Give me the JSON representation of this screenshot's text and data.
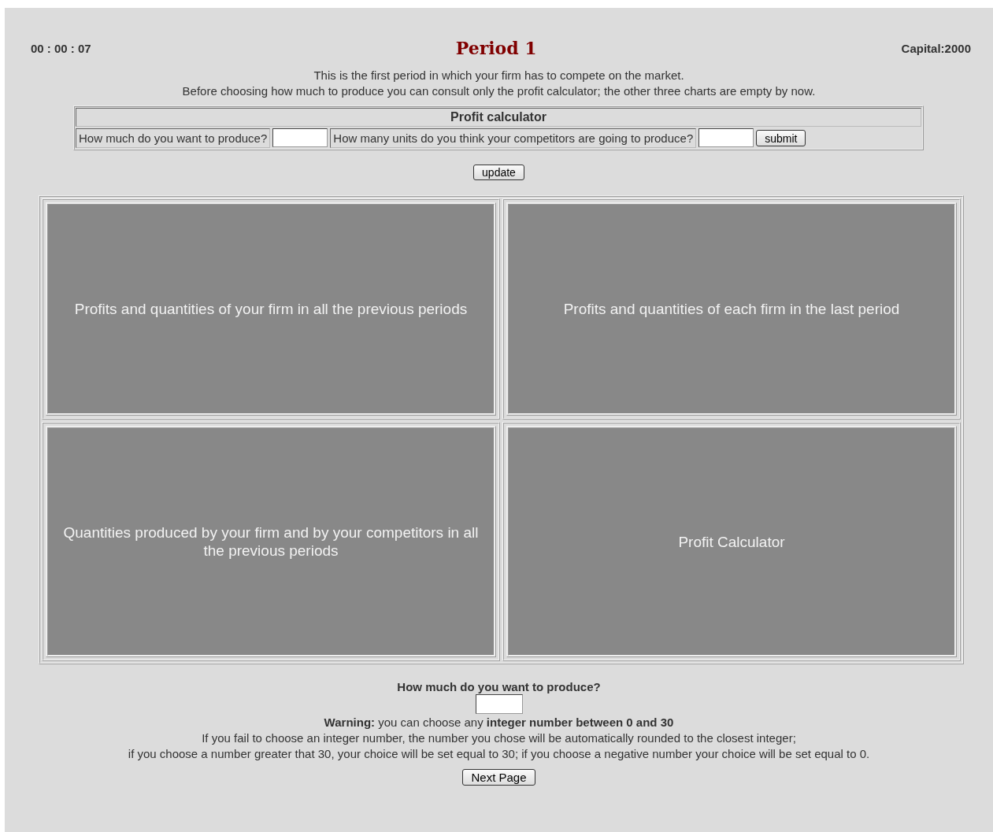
{
  "header": {
    "timer": "00 : 00 : 07",
    "title": "Period 1",
    "capital": "Capital:2000"
  },
  "intro": [
    "This is the first period in which your firm has to compete on the market.",
    "Before choosing how much to produce you can consult only the profit calculator; the other three charts are empty by now."
  ],
  "profit_calculator": {
    "title": "Profit calculator",
    "own_label": "How much do you want to produce?",
    "competitors_label": "How many units do you think your competitors are going to produce?",
    "submit": "submit"
  },
  "update_button": "update",
  "charts": [
    {
      "label": "Profits and quantities of your firm in all the previous periods"
    },
    {
      "label": "Profits and quantities of each firm in the last period"
    },
    {
      "label": "Quantities produced by your firm and by your competitors in all the previous periods"
    },
    {
      "label": "Profit Calculator"
    }
  ],
  "production": {
    "question": "How much do you want to produce?",
    "warning": "**Warning:** you can choose any **integer number between 0 and 30**",
    "notes": [
      "If you fail to choose an integer number, the number you chose will be automatically rounded to the closest integer;",
      "if you choose a number greater that 30, your choice will be set equal to 30; if you choose a negative number your choice will be set equal to 0."
    ]
  },
  "next_button": "Next Page"
}
